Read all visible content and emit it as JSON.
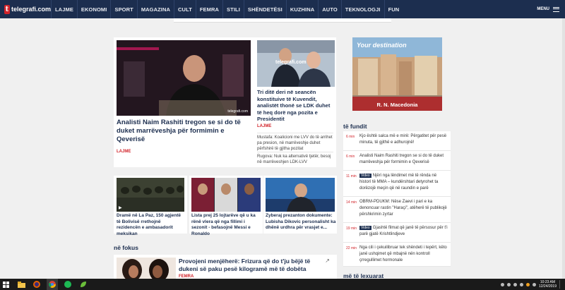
{
  "site": {
    "logo_text": "telegrafi.com",
    "logo_letter": "t"
  },
  "nav": [
    "LAJME",
    "EKONOMI",
    "SPORT",
    "MAGAZINA",
    "CULT",
    "FEMRA",
    "STILI",
    "SHËNDETËSI",
    "KUZHINA",
    "AUTO",
    "TEKNOLOGJI",
    "FUN"
  ],
  "menu_label": "MENU",
  "main_story": {
    "title": "Analisti Naim Rashiti tregon se si do të duket marrëveshja për formimin e Qeverisë",
    "category": "LAJME",
    "watermark": "telegrafi.com"
  },
  "second_story": {
    "title": "Tri ditë deri në seancën konstituive të Kuvendit, analistët thonë se LDK duhet të heq dorë nga pozita e Presidentit",
    "category": "LAJME",
    "watermark": "telegrafi.com",
    "related": [
      "Mustafa: Koalicioni me LVV do të arrihet pa presion, në marrëveshje duhet përfshirë të gjitha pozitat",
      "Rugova: Nuk ka alternativë tjetër, besoj në marrëveshjen LDK-LVV"
    ]
  },
  "small_stories": [
    {
      "title": "Dramë në La Paz, 150 agjentë të Bolivisë rrethojnë rezidencën e ambasadorit meksikan"
    },
    {
      "title": "Lista prej 25 lojtarëve që u ka rënë vlera që nga fillimi i sezonit - befasojnë Messi e Ronaldo"
    },
    {
      "title": "Zyberaj prezanton dokumente: Lubisha Dikovic personalisht ka dhënë urdhra për vrasjet e..."
    }
  ],
  "ne_fokus": {
    "label": "në fokus",
    "story_title": "Provojeni menjëherë: Frizura që do t'ju bëjë të dukeni së paku pesë kilogramë më të dobëta",
    "category": "FEMRA"
  },
  "ad": {
    "headline": "Your destination",
    "caption": "R. N. Macedonia"
  },
  "te_fundit": {
    "label": "të fundit",
    "items": [
      {
        "time": "6 min",
        "video": false,
        "text": "Kjo është salca më e mirë: Përgatitet për pesë minuta, të gjithë e adhurojnë!"
      },
      {
        "time": "6 min",
        "video": false,
        "text": "Analisti Naim Rashiti tregon se si do të duket marrëveshja për formimin e Qeverisë"
      },
      {
        "time": "11 min",
        "video": true,
        "text": "Njëri nga lëndimet më të rënda në historí të MMA – kundërshtari detyrohet ta dorëzojë meçin që në raundin e parë"
      },
      {
        "time": "14 min",
        "video": false,
        "text": "OBRM-PDUKM: Nëse Zaevi i pari e ka denoncuar rastin \"Haraçi\", atëherë të publikojë përshkrimin zyrtar"
      },
      {
        "time": "19 min",
        "video": true,
        "text": "Gjashtë filmat që janë të përsosur për t'i parë gjatë Krishtlindjeve"
      },
      {
        "time": "22 min",
        "video": false,
        "text": "Nga cili i çekuilibruar tek shëndeti i tepërt, këto janë ushqimet që mbajnë nën kontroll çrregullimet hormonale"
      }
    ],
    "video_label": "Video"
  },
  "me_te_lexuarat": {
    "label": "më të lexuarat"
  },
  "taskbar": {
    "time": "10:23 AM",
    "date": "12/24/2019"
  }
}
